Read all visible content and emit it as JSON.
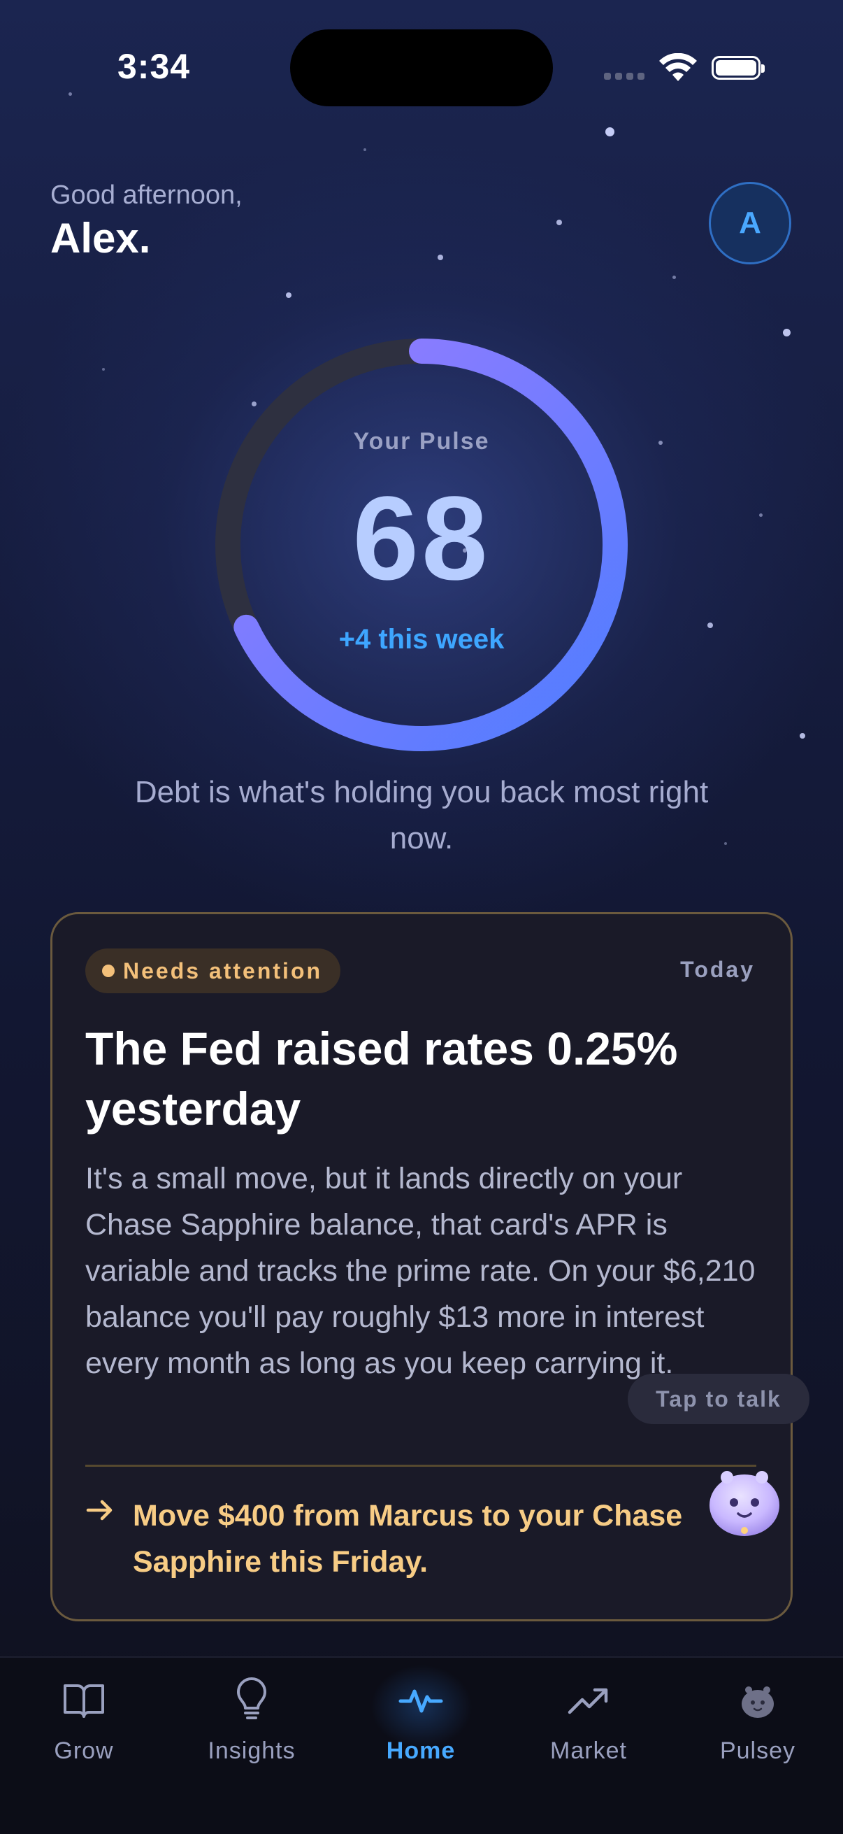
{
  "status_bar": {
    "time": "3:34"
  },
  "header": {
    "greeting": "Good afternoon,",
    "name": "Alex.",
    "avatar_initial": "A"
  },
  "pulse": {
    "label": "Your Pulse",
    "score": "68",
    "score_fraction": 0.68,
    "weekly_change": "+4 this week",
    "message": "Debt is what's holding you back most right now.",
    "colors": {
      "ring_start": "#4f7dff",
      "ring_end": "#9a7bff",
      "track": "#2e3040"
    }
  },
  "insight_card": {
    "badge": "Needs attention",
    "date": "Today",
    "title": "The Fed raised rates 0.25% yesterday",
    "body": "It's a small move, but it lands directly on your Chase Sapphire balance, that card's APR is variable and tracks the prime rate. On your $6,210 balance you'll pay roughly $13 more in interest every month as long as you keep carrying it.",
    "action": "Move $400 from Marcus to your Chase Sapphire this Friday.",
    "colors": {
      "accent": "#f7cc85",
      "border": "#6b5a3e"
    }
  },
  "assistant": {
    "prompt": "Tap to talk",
    "icon": "pulsey-mascot-icon"
  },
  "tab_bar": {
    "items": [
      {
        "label": "Grow",
        "icon": "book-open-icon"
      },
      {
        "label": "Insights",
        "icon": "lightbulb-icon"
      },
      {
        "label": "Home",
        "icon": "pulse-icon",
        "active": true
      },
      {
        "label": "Market",
        "icon": "trending-up-icon"
      },
      {
        "label": "Pulsey",
        "icon": "pulsey-mascot-icon"
      }
    ],
    "colors": {
      "active": "#47a9ff",
      "inactive": "#9aa0bf"
    }
  }
}
